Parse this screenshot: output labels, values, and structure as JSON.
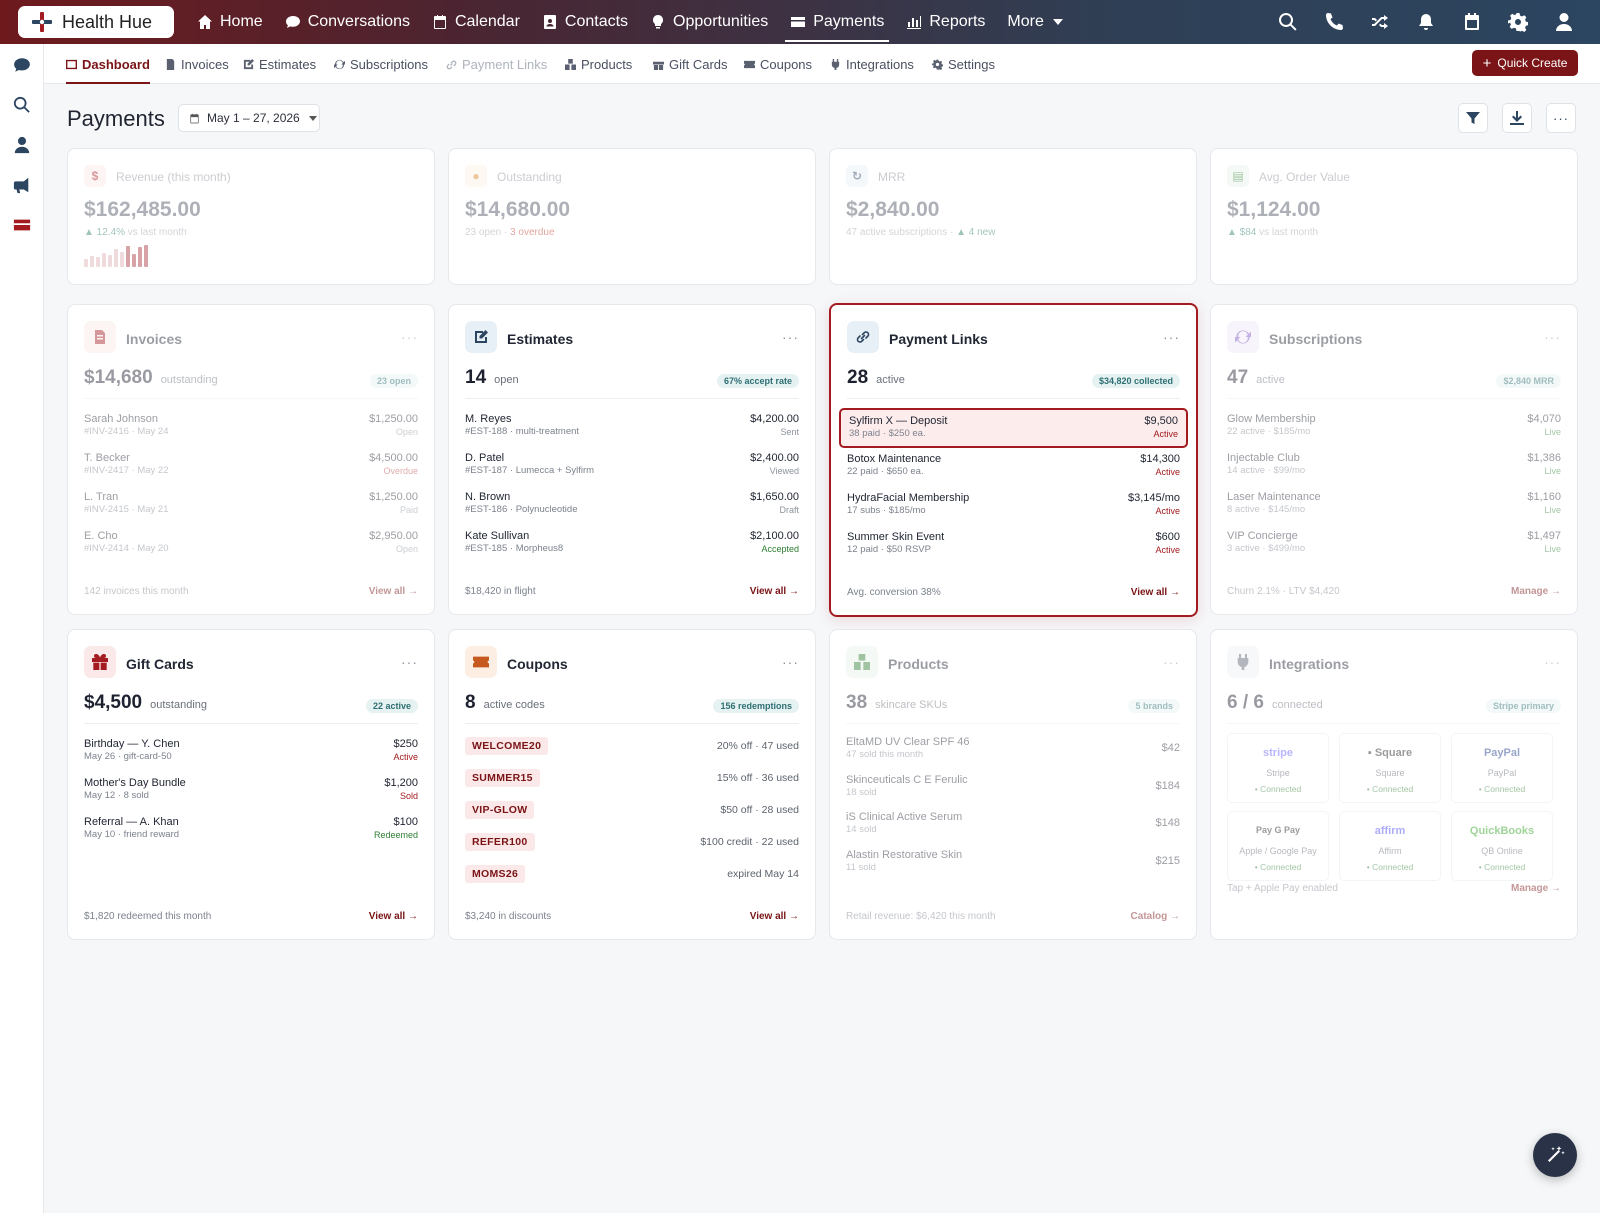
{
  "app": {
    "brand": "Health Hue"
  },
  "nav": [
    {
      "label": "Home",
      "icon": "home-icon"
    },
    {
      "label": "Conversations",
      "icon": "chat-icon"
    },
    {
      "label": "Calendar",
      "icon": "calendar-icon"
    },
    {
      "label": "Contacts",
      "icon": "contacts-icon"
    },
    {
      "label": "Opportunities",
      "icon": "lightbulb-icon"
    },
    {
      "label": "Payments",
      "icon": "credit-card-icon",
      "active": true
    },
    {
      "label": "Reports",
      "icon": "bar-chart-icon"
    },
    {
      "label": "More",
      "icon": "chevron-down-icon"
    }
  ],
  "subnav": [
    {
      "label": "Dashboard",
      "active": true
    },
    {
      "label": "Invoices"
    },
    {
      "label": "Estimates"
    },
    {
      "label": "Subscriptions"
    },
    {
      "label": "Payment Links",
      "dim": true
    },
    {
      "label": "Products"
    },
    {
      "label": "Gift Cards"
    },
    {
      "label": "Coupons"
    },
    {
      "label": "Integrations"
    },
    {
      "label": "Settings"
    }
  ],
  "quick_create": "Quick Create",
  "page": {
    "title": "Payments",
    "date_range": "May 1 – 27, 2026"
  },
  "kpis": {
    "revenue": {
      "label": "Revenue (this month)",
      "value": "$162,485.00",
      "delta": "▲ 12.4%",
      "delta_suffix": " vs last month"
    },
    "outstanding": {
      "label": "Outstanding",
      "value": "$14,680.00",
      "sub": "23 open · ",
      "overdue": "3 overdue"
    },
    "mrr": {
      "label": "MRR",
      "value": "$2,840.00",
      "sub": "47 active subscriptions · ",
      "new": "▲ 4 new"
    },
    "aov": {
      "label": "Avg. Order Value",
      "value": "$1,124.00",
      "delta": "▲ $84",
      "delta_suffix": " vs last month"
    }
  },
  "spark": [
    0.35,
    0.5,
    0.45,
    0.65,
    0.55,
    0.8,
    0.7,
    0.95,
    0.6,
    0.9,
    1.0
  ],
  "invoices": {
    "title": "Invoices",
    "big": "$14,680",
    "unit": "outstanding",
    "badge": "23 open",
    "rows": [
      {
        "t": "Sarah Johnson",
        "s": "#INV-2416 · May 24",
        "a": "$1,250.00",
        "st": "Open"
      },
      {
        "t": "T. Becker",
        "s": "#INV-2417 · May 22",
        "a": "$4,500.00",
        "st": "Overdue"
      },
      {
        "t": "L. Tran",
        "s": "#INV-2415 · May 21",
        "a": "$1,250.00",
        "st": "Paid"
      },
      {
        "t": "E. Cho",
        "s": "#INV-2414 · May 20",
        "a": "$2,950.00",
        "st": "Open"
      }
    ],
    "foot_left": "142 invoices this month",
    "foot_right": "View all →"
  },
  "estimates": {
    "title": "Estimates",
    "big": "14",
    "unit": "open",
    "badge": "67% accept rate",
    "rows": [
      {
        "t": "M. Reyes",
        "s": "#EST-188 · multi-treatment",
        "a": "$4,200.00",
        "st": "Sent"
      },
      {
        "t": "D. Patel",
        "s": "#EST-187 · Lumecca + Sylfirm",
        "a": "$2,400.00",
        "st": "Viewed"
      },
      {
        "t": "N. Brown",
        "s": "#EST-186 · Polynucleotide",
        "a": "$1,650.00",
        "st": "Draft"
      },
      {
        "t": "Kate Sullivan",
        "s": "#EST-185 · Morpheus8",
        "a": "$2,100.00",
        "st": "Accepted"
      }
    ],
    "foot_left": "$18,420 in flight",
    "foot_right": "View all →"
  },
  "payment_links": {
    "title": "Payment Links",
    "big": "28",
    "unit": "active",
    "badge": "$34,820 collected",
    "rows": [
      {
        "t": "Sylfirm X — Deposit",
        "s": "38 paid · $250 ea.",
        "a": "$9,500",
        "st": "Active"
      },
      {
        "t": "Botox Maintenance",
        "s": "22 paid · $650 ea.",
        "a": "$14,300",
        "st": "Active"
      },
      {
        "t": "HydraFacial Membership",
        "s": "17 subs · $185/mo",
        "a": "$3,145/mo",
        "st": "Active"
      },
      {
        "t": "Summer Skin Event",
        "s": "12 paid · $50 RSVP",
        "a": "$600",
        "st": "Active"
      }
    ],
    "foot_left": "Avg. conversion 38%",
    "foot_right": "View all →"
  },
  "subscriptions": {
    "title": "Subscriptions",
    "big": "47",
    "unit": "active",
    "badge": "$2,840 MRR",
    "rows": [
      {
        "t": "Glow Membership",
        "s": "22 active · $185/mo",
        "a": "$4,070",
        "st": "Live"
      },
      {
        "t": "Injectable Club",
        "s": "14 active · $99/mo",
        "a": "$1,386",
        "st": "Live"
      },
      {
        "t": "Laser Maintenance",
        "s": "8 active · $145/mo",
        "a": "$1,160",
        "st": "Live"
      },
      {
        "t": "VIP Concierge",
        "s": "3 active · $499/mo",
        "a": "$1,497",
        "st": "Live"
      }
    ],
    "foot_left": "Churn 2.1% · LTV $4,420",
    "foot_right": "Manage →"
  },
  "gift_cards": {
    "title": "Gift Cards",
    "big": "$4,500",
    "unit": "outstanding",
    "badge": "22 active",
    "rows": [
      {
        "t": "Birthday — Y. Chen",
        "s": "May 26 · gift-card-50",
        "a": "$250",
        "st": "Active"
      },
      {
        "t": "Mother's Day Bundle",
        "s": "May 12 · 8 sold",
        "a": "$1,200",
        "st": "Sold"
      },
      {
        "t": "Referral — A. Khan",
        "s": "May 10 · friend reward",
        "a": "$100",
        "st": "Redeemed"
      }
    ],
    "foot_left": "$1,820 redeemed this month",
    "foot_right": "View all →"
  },
  "coupons": {
    "title": "Coupons",
    "big": "8",
    "unit": "active codes",
    "badge": "156 redemptions",
    "rows": [
      {
        "code": "WELCOME20",
        "d": "20% off · 47 used"
      },
      {
        "code": "SUMMER15",
        "d": "15% off · 36 used"
      },
      {
        "code": "VIP-GLOW",
        "d": "$50 off · 28 used"
      },
      {
        "code": "REFER100",
        "d": "$100 credit · 22 used"
      },
      {
        "code": "MOMS26",
        "d": "expired May 14"
      }
    ],
    "foot_left": "$3,240 in discounts",
    "foot_right": "View all →"
  },
  "products": {
    "title": "Products",
    "big": "38",
    "unit": "skincare SKUs",
    "badge": "5 brands",
    "rows": [
      {
        "t": "EltaMD UV Clear SPF 46",
        "s": "47 sold this month",
        "a": "$42"
      },
      {
        "t": "Skinceuticals C E Ferulic",
        "s": "18 sold",
        "a": "$184"
      },
      {
        "t": "iS Clinical Active Serum",
        "s": "14 sold",
        "a": "$148"
      },
      {
        "t": "Alastin Restorative Skin",
        "s": "11 sold",
        "a": "$215"
      }
    ],
    "foot_left": "Retail revenue: $6,420 this month",
    "foot_right": "Catalog →"
  },
  "integrations": {
    "title": "Integrations",
    "big": "6 / 6",
    "unit": "connected",
    "badge": "Stripe primary",
    "tiles": [
      {
        "brand": "stripe",
        "name": "Stripe",
        "status": "• Connected",
        "color": "#635bff"
      },
      {
        "brand": "▪ Square",
        "name": "Square",
        "status": "• Connected",
        "color": "#222"
      },
      {
        "brand": "PayPal",
        "name": "PayPal",
        "status": "• Connected",
        "color": "#1b3a8a"
      },
      {
        "brand": "Pay  G Pay",
        "name": "Apple / Google Pay",
        "status": "• Connected",
        "color": "#222"
      },
      {
        "brand": "affirm",
        "name": "Affirm",
        "status": "• Connected",
        "color": "#4a4af4"
      },
      {
        "brand": "QuickBooks",
        "name": "QB Online",
        "status": "• Connected",
        "color": "#2ca01c"
      }
    ],
    "foot_left": "Tap + Apple Pay enabled",
    "foot_right": "Manage →"
  },
  "colors": {
    "brand": "#7a1416",
    "focus": "#a31b20",
    "teal_badge": "#2e6f73"
  }
}
